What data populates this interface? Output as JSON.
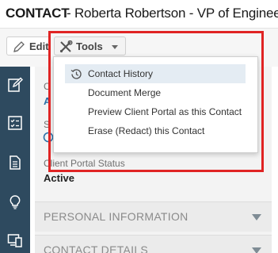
{
  "header": {
    "record_type": "CONTACT",
    "record_title": " - Roberta Robertson - VP of Engineering"
  },
  "toolbar": {
    "edit_label": "Edit",
    "tools_label": "Tools"
  },
  "tools_menu": {
    "items": [
      {
        "label": "Contact History",
        "icon": "history-icon"
      },
      {
        "label": "Document Merge"
      },
      {
        "label": "Preview Client Portal as this Contact"
      },
      {
        "label": "Erase (Redact) this Contact"
      }
    ]
  },
  "fields": {
    "partial_label_1": "C",
    "partial_value_1": "A",
    "partial_label_2": "S",
    "portal_status_label": "Client Portal Status",
    "portal_status_value": "Active"
  },
  "sections": [
    {
      "label": "PERSONAL INFORMATION"
    },
    {
      "label": "CONTACT DETAILS"
    }
  ],
  "side_nav": {
    "icons": [
      "edit-icon",
      "checklist-icon",
      "document-icon",
      "lightbulb-icon",
      "devices-icon"
    ]
  },
  "colors": {
    "side_nav_bg": "#2e4a5f",
    "highlight_border": "#e02424",
    "accent_link": "#2b6fa6",
    "menu_hover": "#e4ecf3"
  }
}
